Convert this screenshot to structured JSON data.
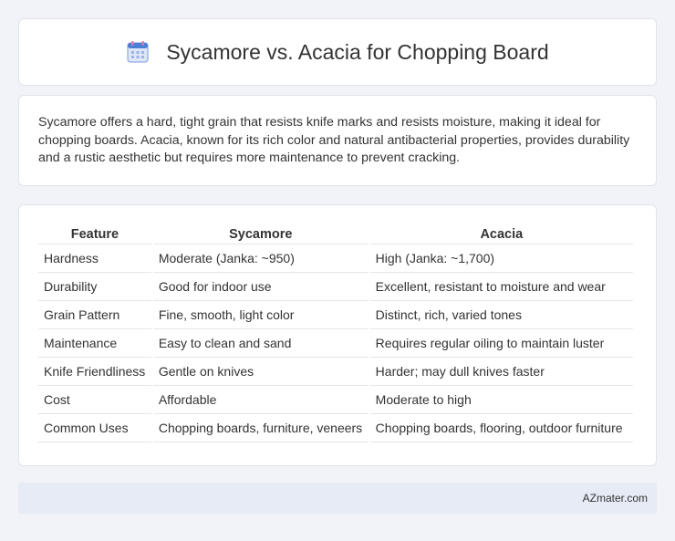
{
  "header": {
    "title": "Sycamore vs. Acacia for Chopping Board",
    "icon": "calendar-icon"
  },
  "description": "Sycamore offers a hard, tight grain that resists knife marks and resists moisture, making it ideal for chopping boards. Acacia, known for its rich color and natural antibacterial properties, provides durability and a rustic aesthetic but requires more maintenance to prevent cracking.",
  "table": {
    "headers": [
      "Feature",
      "Sycamore",
      "Acacia"
    ],
    "rows": [
      [
        "Hardness",
        "Moderate (Janka: ~950)",
        "High (Janka: ~1,700)"
      ],
      [
        "Durability",
        "Good for indoor use",
        "Excellent, resistant to moisture and wear"
      ],
      [
        "Grain Pattern",
        "Fine, smooth, light color",
        "Distinct, rich, varied tones"
      ],
      [
        "Maintenance",
        "Easy to clean and sand",
        "Requires regular oiling to maintain luster"
      ],
      [
        "Knife Friendliness",
        "Gentle on knives",
        "Harder; may dull knives faster"
      ],
      [
        "Cost",
        "Affordable",
        "Moderate to high"
      ],
      [
        "Common Uses",
        "Chopping boards, furniture, veneers",
        "Chopping boards, flooring, outdoor furniture"
      ]
    ]
  },
  "footer": {
    "brand": "AZmater.com"
  },
  "colors": {
    "background": "#f1f3f8",
    "footer_bg": "#e6ebf6",
    "icon_blue": "#4a7fd8",
    "icon_pink": "#e07aa9"
  }
}
